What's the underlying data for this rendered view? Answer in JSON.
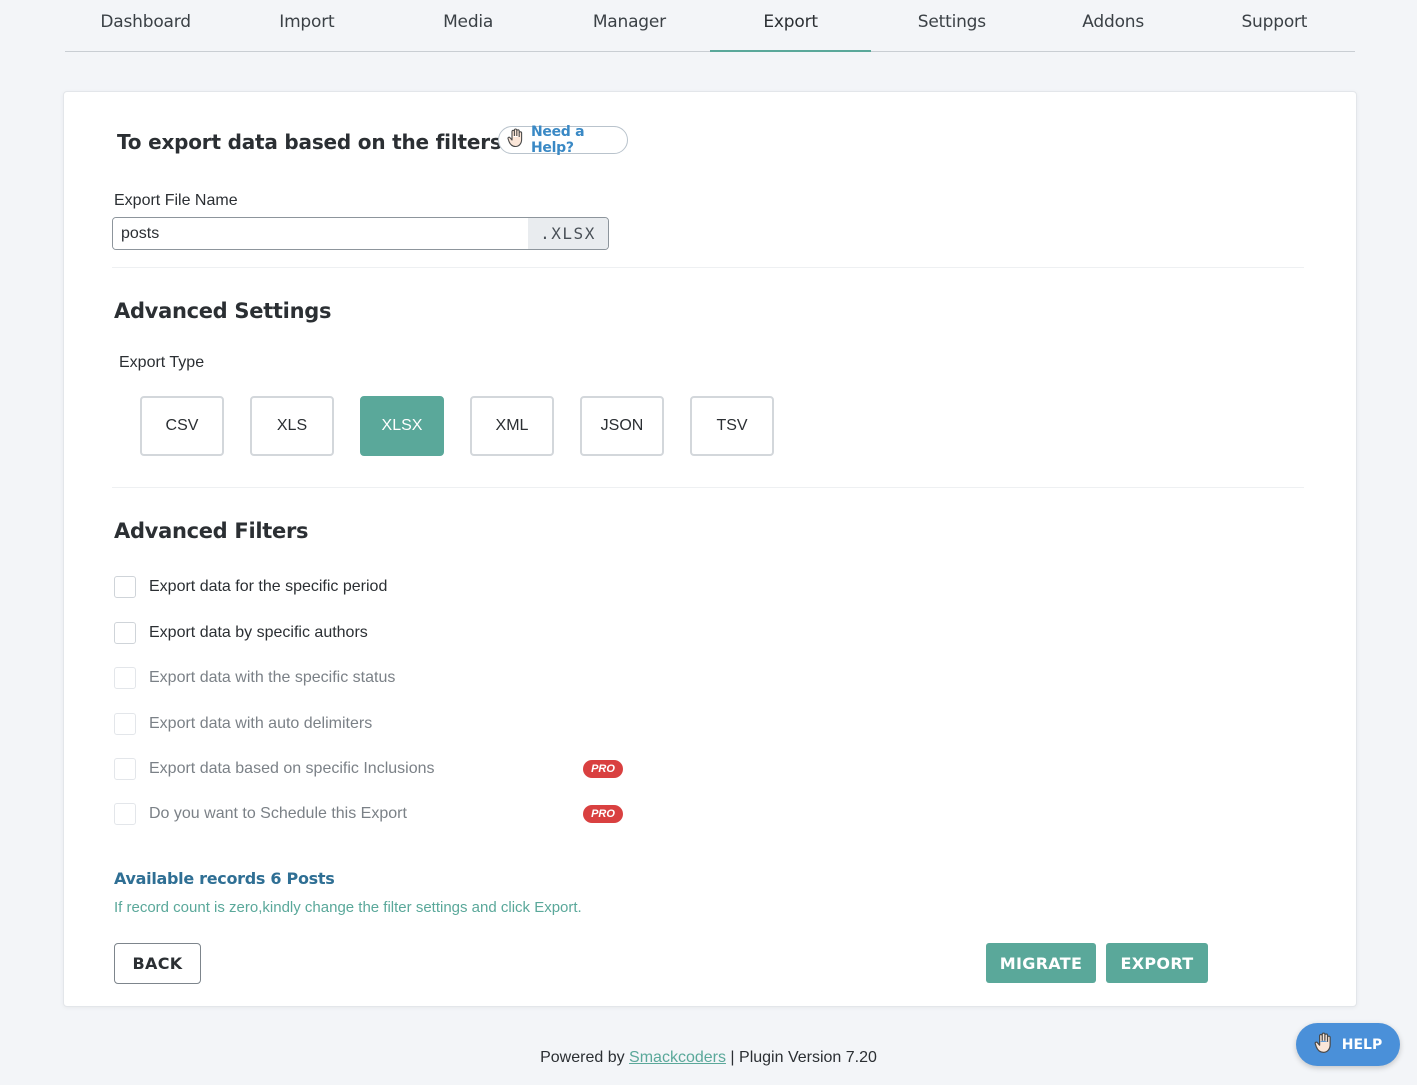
{
  "nav": {
    "tabs": [
      {
        "label": "Dashboard"
      },
      {
        "label": "Import"
      },
      {
        "label": "Media"
      },
      {
        "label": "Manager"
      },
      {
        "label": "Export",
        "active": true
      },
      {
        "label": "Settings"
      },
      {
        "label": "Addons"
      },
      {
        "label": "Support"
      }
    ]
  },
  "header": {
    "title": "To export data based on the filters",
    "help_chip": "Need a Help?"
  },
  "file_name": {
    "label": "Export File Name",
    "value": "posts",
    "extension": ".XLSX"
  },
  "advanced_settings": {
    "title": "Advanced Settings",
    "export_type_label": "Export Type",
    "types": [
      {
        "label": "CSV"
      },
      {
        "label": "XLS"
      },
      {
        "label": "XLSX",
        "selected": true
      },
      {
        "label": "XML"
      },
      {
        "label": "JSON"
      },
      {
        "label": "TSV"
      }
    ]
  },
  "advanced_filters": {
    "title": "Advanced Filters",
    "items": [
      {
        "label": "Export data for the specific period"
      },
      {
        "label": "Export data by specific authors"
      },
      {
        "label": "Export data with the specific status",
        "disabled": true
      },
      {
        "label": "Export data with auto delimiters",
        "disabled": true
      },
      {
        "label": "Export data based on specific Inclusions",
        "disabled": true,
        "badge": "PRO"
      },
      {
        "label": "Do you want to Schedule this Export",
        "disabled": true,
        "badge": "PRO"
      }
    ]
  },
  "records": {
    "text": "Available records 6 Posts",
    "note": "If record count is zero,kindly change the filter settings and click Export."
  },
  "actions": {
    "back": "BACK",
    "migrate": "MIGRATE",
    "export": "EXPORT"
  },
  "footer": {
    "prefix": "Powered by ",
    "link": "Smackcoders",
    "suffix": " | Plugin Version 7.20"
  },
  "help_fab": {
    "label": "HELP"
  },
  "colors": {
    "accent": "#5aa89a",
    "pro": "#d94040",
    "fab": "#4a90d9"
  }
}
